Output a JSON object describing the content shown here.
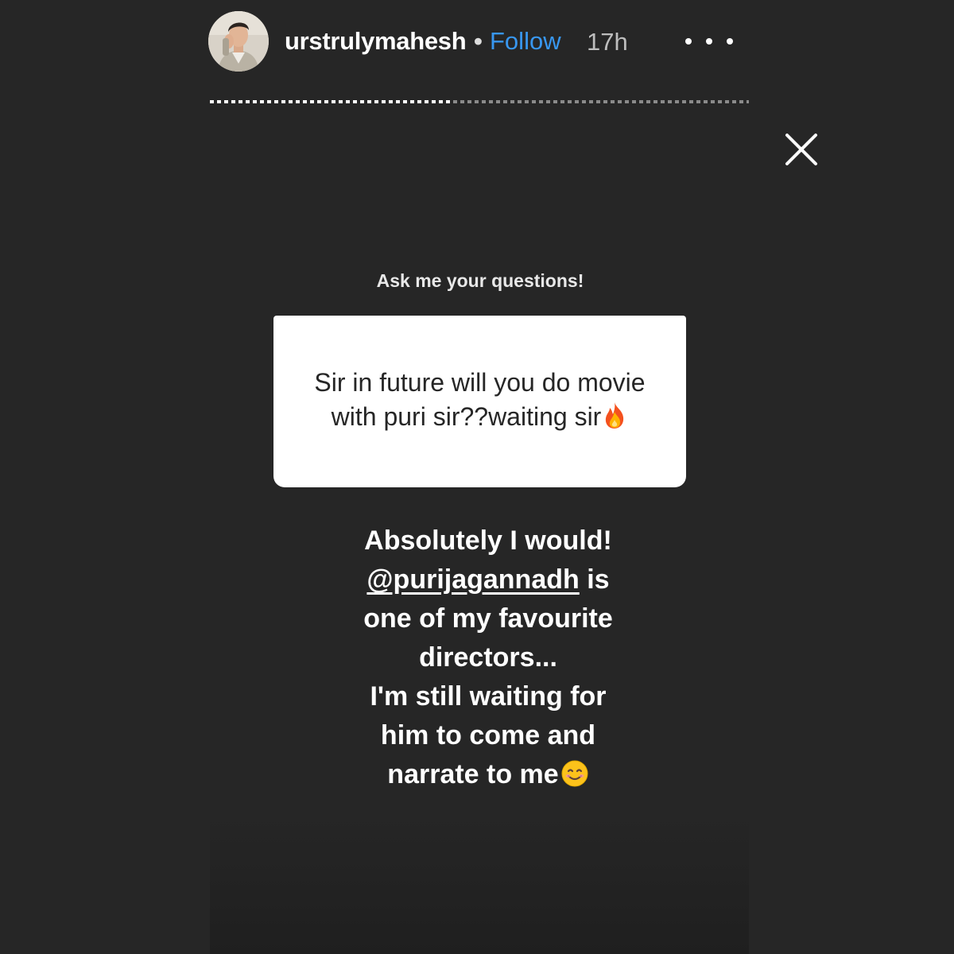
{
  "header": {
    "username": "urstrulymahesh",
    "separator": "•",
    "follow_label": "Follow",
    "timestamp": "17h"
  },
  "icons": {
    "more": "more-options-icon",
    "close": "close-icon",
    "fire": "fire-emoji",
    "smile": "smiling-face-emoji"
  },
  "story": {
    "progress_fraction": 0.45
  },
  "question_sticker": {
    "prompt": "Ask me your questions!",
    "question_text": "Sir in future will you do movie with puri sir??waiting sir"
  },
  "answer": {
    "line1": "Absolutely I would!",
    "mention": "@purijagannadh",
    "line2_rest": " is",
    "line3": "one of my favourite",
    "line4": "directors...",
    "line5": "I'm still waiting for",
    "line6": "him to come and",
    "line7": "narrate to me"
  },
  "colors": {
    "background": "#262626",
    "follow": "#3897f0",
    "card": "#ffffff",
    "card_text": "#262626"
  }
}
